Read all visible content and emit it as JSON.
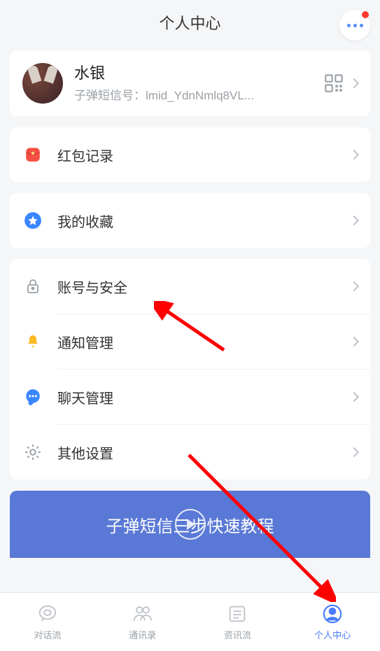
{
  "header": {
    "title": "个人中心"
  },
  "profile": {
    "name": "水银",
    "id_label": "子弹短信号：lmid_YdnNmlq8VL..."
  },
  "redpacket": {
    "label": "红包记录"
  },
  "favorites": {
    "label": "我的收藏"
  },
  "settings": {
    "security": "账号与安全",
    "notifications": "通知管理",
    "chat": "聊天管理",
    "other": "其他设置"
  },
  "tutorial": {
    "title": "子弹短信三步快速教程"
  },
  "tabs": {
    "chat": "对话流",
    "contacts": "通讯录",
    "news": "资讯流",
    "profile": "个人中心"
  },
  "colors": {
    "accent": "#4a7cff",
    "red": "#f64f43",
    "yellow": "#fabb23",
    "blue": "#3a86ff"
  }
}
